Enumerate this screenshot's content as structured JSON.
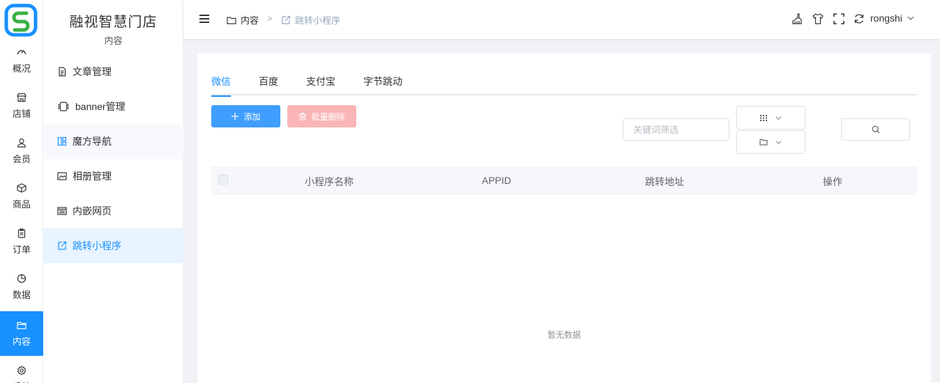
{
  "app": {
    "brand": "融视智慧门店"
  },
  "rail": {
    "items": [
      {
        "label": "概况",
        "icon": "dashboard-icon"
      },
      {
        "label": "店铺",
        "icon": "shop-icon"
      },
      {
        "label": "会员",
        "icon": "user-icon"
      },
      {
        "label": "商品",
        "icon": "box-icon"
      },
      {
        "label": "订单",
        "icon": "clipboard-icon"
      },
      {
        "label": "数据",
        "icon": "pie-chart-icon"
      },
      {
        "label": "内容",
        "icon": "folder-icon",
        "active": true
      },
      {
        "label": "系统",
        "icon": "gear-icon"
      }
    ]
  },
  "submenu": {
    "title": "内容",
    "items": [
      {
        "label": "文章管理",
        "icon": "document-icon"
      },
      {
        "label": "banner管理",
        "icon": "carousel-icon"
      },
      {
        "label": "魔方导航",
        "icon": "grid-nav-icon"
      },
      {
        "label": "相册管理",
        "icon": "picture-icon"
      },
      {
        "label": "内嵌网页",
        "icon": "web-page-icon"
      },
      {
        "label": "跳转小程序",
        "icon": "share-icon",
        "active": true
      }
    ]
  },
  "header": {
    "breadcrumb": [
      {
        "label": "内容",
        "icon": "folder-icon"
      },
      {
        "label": "跳转小程序",
        "icon": "share-icon"
      }
    ],
    "breadcrumb_separator": ">",
    "user": "rongshi"
  },
  "tabs": [
    "微信",
    "百度",
    "支付宝",
    "字节跳动"
  ],
  "toolbar": {
    "add_label": "添加",
    "batch_delete_label": "批量删除",
    "keyword_placeholder": "关键词筛选"
  },
  "table": {
    "columns": [
      "小程序名称",
      "APPID",
      "跳转地址",
      "操作"
    ],
    "empty_text": "暂无数据"
  },
  "colors": {
    "primary": "#1890ff",
    "button_primary": "#409eff",
    "danger_disabled": "#fab6b6"
  }
}
